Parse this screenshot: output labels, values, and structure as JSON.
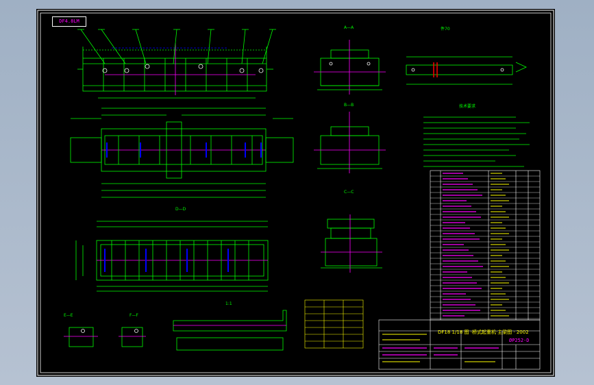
{
  "sheet": {
    "stamp": "DF4.8LM",
    "drawing_number": "ØP252-D",
    "title_text": "DF18 1/18 图 ·桥式起重机·主梁图 · 2002"
  },
  "views": {
    "section_a": "A—A",
    "section_b": "B—B",
    "section_c": "C—C",
    "section_d": "D—D",
    "section_e": "E—E",
    "section_f": "F—F",
    "detail_note": "技术要求",
    "rail_title": "件70",
    "rail_scale": "1:1"
  },
  "colors": {
    "background": "#000000",
    "outline": "#00ff00",
    "dimension": "#00ff00",
    "centerline": "#ff00ff",
    "hidden": "#0000ff",
    "text_yellow": "#ffff00",
    "border": "#ffffff"
  }
}
